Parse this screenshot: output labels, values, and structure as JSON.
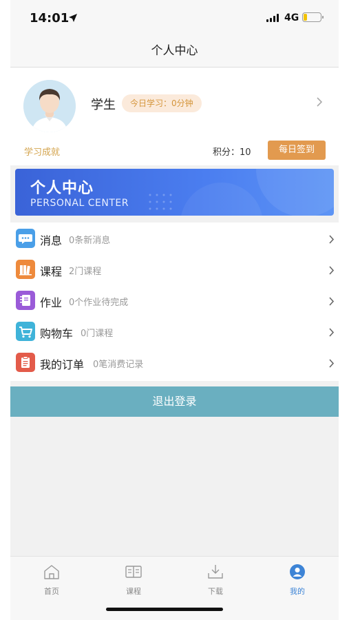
{
  "status_bar": {
    "time": "14:01",
    "network": "4G"
  },
  "nav": {
    "title": "个人中心"
  },
  "profile": {
    "name": "学生",
    "study_today": "今日学习：0分钟",
    "achievements_label": "学习成就",
    "points_label": "积分：10",
    "checkin_label": "每日签到"
  },
  "banner": {
    "title": "个人中心",
    "subtitle": "PERSONAL CENTER"
  },
  "menu": {
    "items": [
      {
        "label": "消息",
        "sub": "0条新消息",
        "icon": "message-icon",
        "color": "#4a9fe8"
      },
      {
        "label": "课程",
        "sub": "2门课程",
        "icon": "books-icon",
        "color": "#ee8a3c"
      },
      {
        "label": "作业",
        "sub": "0个作业待完成",
        "icon": "notebook-icon",
        "color": "#9a5bd8"
      },
      {
        "label": "购物车",
        "sub": "0门课程",
        "icon": "cart-icon",
        "color": "#3fb3d9"
      },
      {
        "label": "我的订单",
        "sub": "0笔消费记录",
        "icon": "clipboard-icon",
        "color": "#e35b4a"
      }
    ]
  },
  "logout": {
    "label": "退出登录"
  },
  "tabbar": {
    "tabs": [
      {
        "label": "首页",
        "icon": "home-icon"
      },
      {
        "label": "课程",
        "icon": "course-icon"
      },
      {
        "label": "下载",
        "icon": "download-icon"
      },
      {
        "label": "我的",
        "icon": "user-icon",
        "active": true
      }
    ]
  }
}
